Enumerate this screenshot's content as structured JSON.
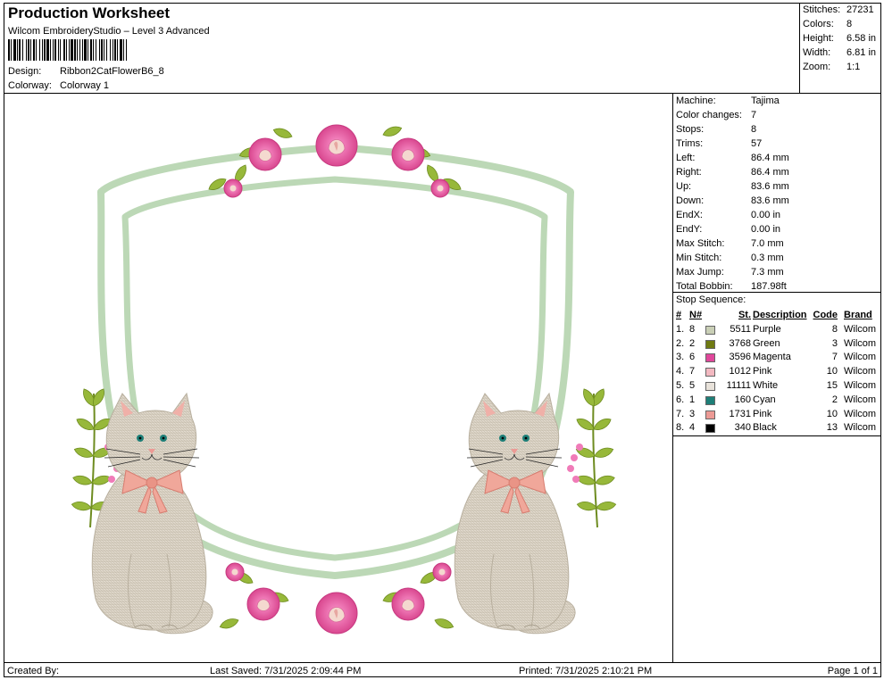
{
  "header": {
    "title": "Production Worksheet",
    "software": "Wilcom EmbroideryStudio – Level 3 Advanced",
    "design_label": "Design:",
    "design_value": "Ribbon2CatFlowerB6_8",
    "colorway_label": "Colorway:",
    "colorway_value": "Colorway 1"
  },
  "summary": [
    {
      "label": "Stitches:",
      "value": "27231"
    },
    {
      "label": "Colors:",
      "value": "8"
    },
    {
      "label": "Height:",
      "value": "6.58 in"
    },
    {
      "label": "Width:",
      "value": "6.81 in"
    },
    {
      "label": "Zoom:",
      "value": "1:1"
    }
  ],
  "machine_info": [
    {
      "label": "Machine:",
      "value": "Tajima"
    },
    {
      "label": "Color changes:",
      "value": "7"
    },
    {
      "label": "Stops:",
      "value": "8"
    },
    {
      "label": "Trims:",
      "value": "57"
    },
    {
      "label": "Left:",
      "value": "86.4 mm"
    },
    {
      "label": "Right:",
      "value": "86.4 mm"
    },
    {
      "label": "Up:",
      "value": "83.6 mm"
    },
    {
      "label": "Down:",
      "value": "83.6 mm"
    },
    {
      "label": "EndX:",
      "value": "0.00 in"
    },
    {
      "label": "EndY:",
      "value": "0.00 in"
    },
    {
      "label": "Max Stitch:",
      "value": "7.0 mm"
    },
    {
      "label": "Min Stitch:",
      "value": "0.3 mm"
    },
    {
      "label": "Max Jump:",
      "value": "7.3 mm"
    },
    {
      "label": "Total Bobbin:",
      "value": "187.98ft"
    }
  ],
  "stop_sequence": {
    "title": "Stop Sequence:",
    "columns": {
      "idx": "#",
      "n": "N#",
      "st": "St.",
      "desc": "Description",
      "code": "Code",
      "brand": "Brand"
    },
    "rows": [
      {
        "idx": "1.",
        "n": "8",
        "color": "#c9cfb6",
        "st": "5511",
        "desc": "Purple",
        "code": "8",
        "brand": "Wilcom"
      },
      {
        "idx": "2.",
        "n": "2",
        "color": "#6f7a12",
        "st": "3768",
        "desc": "Green",
        "code": "3",
        "brand": "Wilcom"
      },
      {
        "idx": "3.",
        "n": "6",
        "color": "#e0479b",
        "st": "3596",
        "desc": "Magenta",
        "code": "7",
        "brand": "Wilcom"
      },
      {
        "idx": "4.",
        "n": "7",
        "color": "#f3b9c1",
        "st": "1012",
        "desc": "Pink",
        "code": "10",
        "brand": "Wilcom"
      },
      {
        "idx": "5.",
        "n": "5",
        "color": "#e8e2da",
        "st": "11111",
        "desc": "White",
        "code": "15",
        "brand": "Wilcom"
      },
      {
        "idx": "6.",
        "n": "1",
        "color": "#1e7f78",
        "st": "160",
        "desc": "Cyan",
        "code": "2",
        "brand": "Wilcom"
      },
      {
        "idx": "7.",
        "n": "3",
        "color": "#ec9a95",
        "st": "1731",
        "desc": "Pink",
        "code": "10",
        "brand": "Wilcom"
      },
      {
        "idx": "8.",
        "n": "4",
        "color": "#000000",
        "st": "340",
        "desc": "Black",
        "code": "13",
        "brand": "Wilcom"
      }
    ]
  },
  "footer": {
    "created_by": "Created By:",
    "last_saved": "Last Saved: 7/31/2025 2:09:44 PM",
    "printed": "Printed: 7/31/2025 2:10:21 PM",
    "page": "Page 1 of 1"
  },
  "colors": {
    "frame_green": "#bcd8b6",
    "rose_pink": "#e77fb6",
    "leaf_green": "#8fb335",
    "cat_fur": "#d9d2c4",
    "bow_pink": "#f0a79a"
  }
}
